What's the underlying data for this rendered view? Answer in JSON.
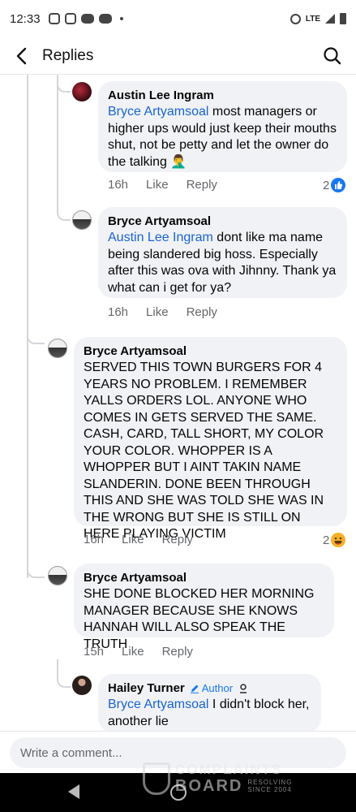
{
  "status_bar": {
    "time": "12:33",
    "network": "LTE",
    "app_icons": [
      "instagram-icon",
      "instagram-icon",
      "youtube-icon",
      "youtube-icon"
    ]
  },
  "header": {
    "title": "Replies"
  },
  "comments": [
    {
      "author": "Austin Lee Ingram",
      "mention": "Bryce Artyamsoal",
      "text": " most managers or higher ups would just keep their mouths shut, not be petty and let the owner do the talking 🤦‍♂️",
      "time": "16h",
      "like_label": "Like",
      "reply_label": "Reply",
      "reaction_count": "2",
      "reaction_icon": "like-reaction-icon"
    },
    {
      "author": "Bryce Artyamsoal",
      "mention": "Austin Lee Ingram",
      "text": " dont like ma name being slandered big hoss. Especially after this was ova with Jihnny. Thank ya what can i get for ya?",
      "time": "16h",
      "like_label": "Like",
      "reply_label": "Reply"
    },
    {
      "author": "Bryce Artyamsoal",
      "text": "SERVED THIS TOWN BURGERS FOR 4 YEARS NO PROBLEM. I REMEMBER YALLS ORDERS LOL. ANYONE WHO COMES IN GETS SERVED THE SAME. CASH, CARD, TALL SHORT, MY COLOR YOUR COLOR. WHOPPER IS A WHOPPER BUT I AINT TAKIN NAME SLANDERIN. DONE BEEN THROUGH THIS AND SHE WAS TOLD SHE WAS IN THE WRONG BUT SHE IS STILL ON HERE PLAYING VICTIM",
      "time": "16h",
      "like_label": "Like",
      "reply_label": "Reply",
      "reaction_count": "2",
      "reaction_icon": "haha-reaction-icon"
    },
    {
      "author": "Bryce Artyamsoal",
      "text": "SHE DONE BLOCKED HER MORNING MANAGER BECAUSE SHE KNOWS HANNAH WILL ALSO SPEAK THE TRUTH",
      "time": "15h",
      "like_label": "Like",
      "reply_label": "Reply"
    },
    {
      "author": "Hailey Turner",
      "badge": "Author",
      "mention": "Bryce Artyamsoal",
      "text": " I didn't block her, another lie"
    }
  ],
  "composer": {
    "placeholder": "Write a comment..."
  },
  "watermark": {
    "line1": "COMPLAINTS",
    "line2": "BOARD",
    "tag1": "RESOLVING",
    "tag2": "SINCE 2004"
  },
  "colors": {
    "mention": "#1b63d4",
    "bubble": "#f0f2f5",
    "meta": "#65676b",
    "like_blue": "#1877f2",
    "haha_yellow": "#f7b125"
  }
}
